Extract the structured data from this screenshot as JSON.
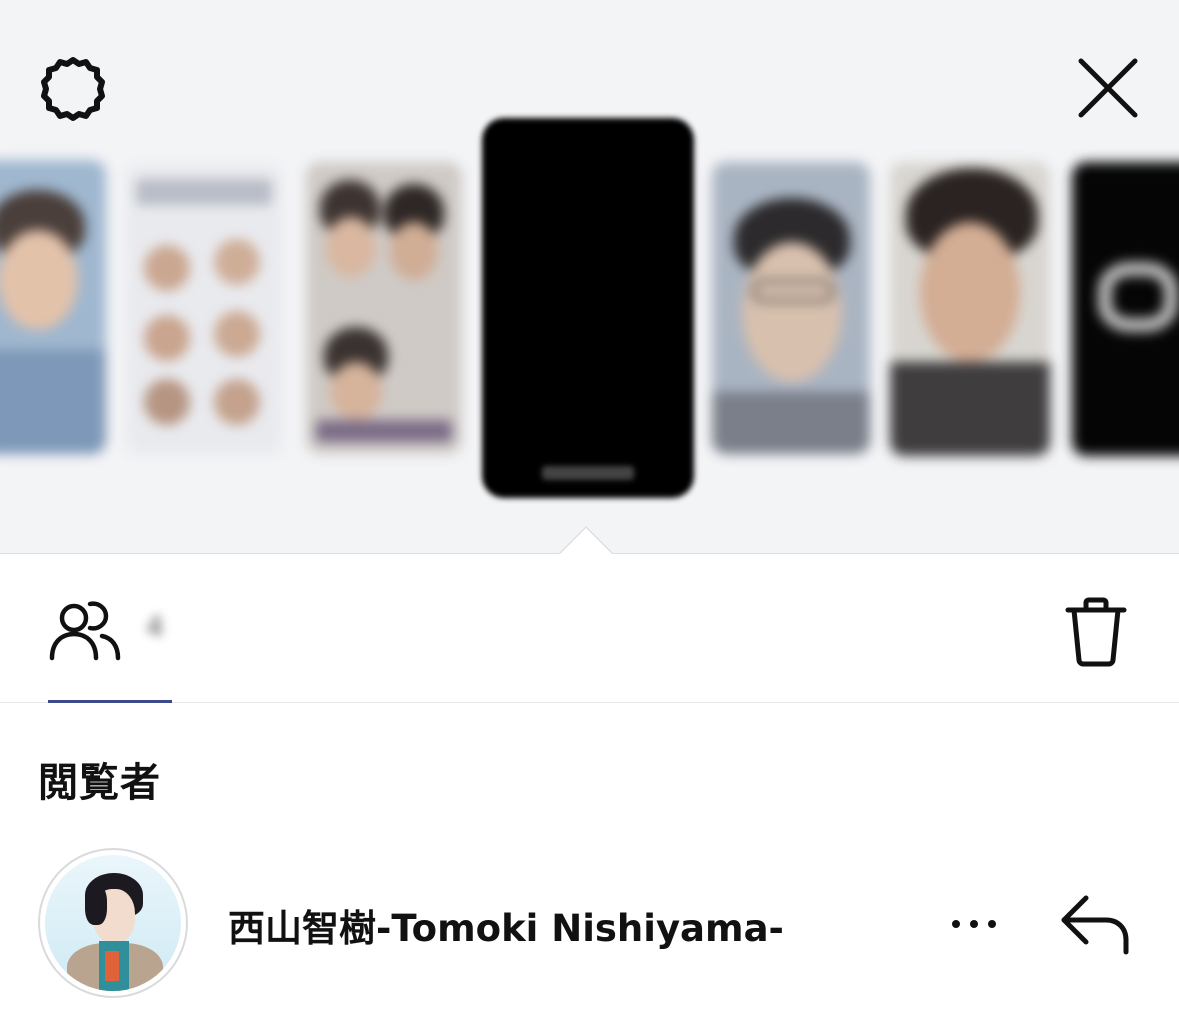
{
  "header": {
    "settings_icon": "settings-gear-icon",
    "close_icon": "close-icon"
  },
  "story_strip": {
    "thumbnails": [
      {
        "name": "story-thumb-1"
      },
      {
        "name": "story-thumb-2"
      },
      {
        "name": "story-thumb-3"
      },
      {
        "name": "story-thumb-active"
      },
      {
        "name": "story-thumb-5"
      },
      {
        "name": "story-thumb-6"
      },
      {
        "name": "story-thumb-7"
      }
    ]
  },
  "stats": {
    "viewers_icon": "people-icon",
    "view_count": "4",
    "delete_icon": "trash-icon"
  },
  "viewers": {
    "title": "閲覧者",
    "items": [
      {
        "name": "西山智樹-Tomoki Nishiyama-",
        "more_icon": "ellipsis-icon",
        "reply_icon": "reply-icon"
      }
    ]
  },
  "colors": {
    "panel_bg": "#f3f4f6",
    "tab_underline": "#3b4a8a",
    "text": "#111111"
  }
}
